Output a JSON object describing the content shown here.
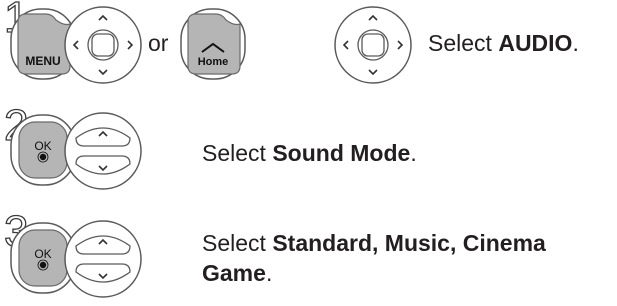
{
  "steps": [
    {
      "number": "1",
      "buttons": [
        "menu-button",
        "nav-dpad"
      ],
      "separator": "or",
      "alt_buttons": [
        "home-button",
        "nav-dpad"
      ],
      "text_prefix": "Select ",
      "text_bold": "AUDIO",
      "text_suffix": "."
    },
    {
      "number": "2",
      "buttons": [
        "ok-button",
        "up-down-rocker"
      ],
      "text_prefix": "Select ",
      "text_bold": "Sound Mode",
      "text_suffix": "."
    },
    {
      "number": "3",
      "buttons": [
        "ok-button",
        "up-down-rocker"
      ],
      "text_prefix": "Select ",
      "text_bold": "Standard, Music, Cinema",
      "text_line2_bold": "Game",
      "text_line2_suffix": "."
    }
  ],
  "buttons": {
    "menu_label": "MENU",
    "home_label": "Home",
    "ok_label": "OK"
  }
}
